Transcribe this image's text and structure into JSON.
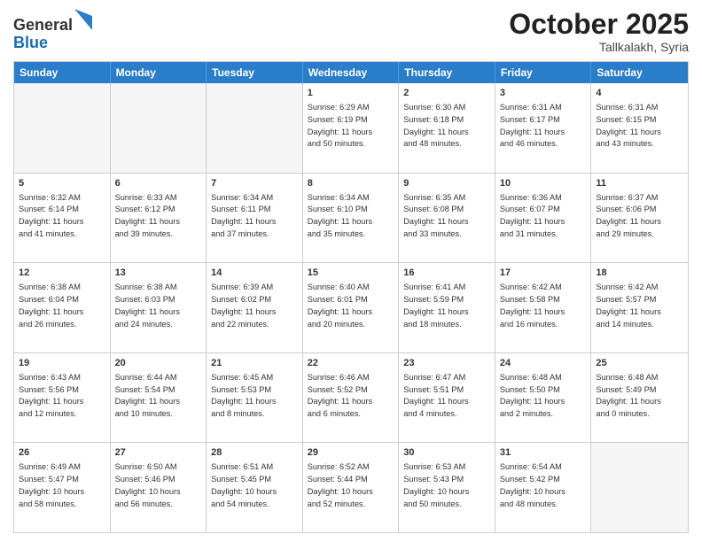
{
  "header": {
    "logo_general": "General",
    "logo_blue": "Blue",
    "month_title": "October 2025",
    "location": "Tallkalakh, Syria"
  },
  "weekdays": [
    "Sunday",
    "Monday",
    "Tuesday",
    "Wednesday",
    "Thursday",
    "Friday",
    "Saturday"
  ],
  "rows": [
    [
      {
        "day": "",
        "text": ""
      },
      {
        "day": "",
        "text": ""
      },
      {
        "day": "",
        "text": ""
      },
      {
        "day": "1",
        "text": "Sunrise: 6:29 AM\nSunset: 6:19 PM\nDaylight: 11 hours\nand 50 minutes."
      },
      {
        "day": "2",
        "text": "Sunrise: 6:30 AM\nSunset: 6:18 PM\nDaylight: 11 hours\nand 48 minutes."
      },
      {
        "day": "3",
        "text": "Sunrise: 6:31 AM\nSunset: 6:17 PM\nDaylight: 11 hours\nand 46 minutes."
      },
      {
        "day": "4",
        "text": "Sunrise: 6:31 AM\nSunset: 6:15 PM\nDaylight: 11 hours\nand 43 minutes."
      }
    ],
    [
      {
        "day": "5",
        "text": "Sunrise: 6:32 AM\nSunset: 6:14 PM\nDaylight: 11 hours\nand 41 minutes."
      },
      {
        "day": "6",
        "text": "Sunrise: 6:33 AM\nSunset: 6:12 PM\nDaylight: 11 hours\nand 39 minutes."
      },
      {
        "day": "7",
        "text": "Sunrise: 6:34 AM\nSunset: 6:11 PM\nDaylight: 11 hours\nand 37 minutes."
      },
      {
        "day": "8",
        "text": "Sunrise: 6:34 AM\nSunset: 6:10 PM\nDaylight: 11 hours\nand 35 minutes."
      },
      {
        "day": "9",
        "text": "Sunrise: 6:35 AM\nSunset: 6:08 PM\nDaylight: 11 hours\nand 33 minutes."
      },
      {
        "day": "10",
        "text": "Sunrise: 6:36 AM\nSunset: 6:07 PM\nDaylight: 11 hours\nand 31 minutes."
      },
      {
        "day": "11",
        "text": "Sunrise: 6:37 AM\nSunset: 6:06 PM\nDaylight: 11 hours\nand 29 minutes."
      }
    ],
    [
      {
        "day": "12",
        "text": "Sunrise: 6:38 AM\nSunset: 6:04 PM\nDaylight: 11 hours\nand 26 minutes."
      },
      {
        "day": "13",
        "text": "Sunrise: 6:38 AM\nSunset: 6:03 PM\nDaylight: 11 hours\nand 24 minutes."
      },
      {
        "day": "14",
        "text": "Sunrise: 6:39 AM\nSunset: 6:02 PM\nDaylight: 11 hours\nand 22 minutes."
      },
      {
        "day": "15",
        "text": "Sunrise: 6:40 AM\nSunset: 6:01 PM\nDaylight: 11 hours\nand 20 minutes."
      },
      {
        "day": "16",
        "text": "Sunrise: 6:41 AM\nSunset: 5:59 PM\nDaylight: 11 hours\nand 18 minutes."
      },
      {
        "day": "17",
        "text": "Sunrise: 6:42 AM\nSunset: 5:58 PM\nDaylight: 11 hours\nand 16 minutes."
      },
      {
        "day": "18",
        "text": "Sunrise: 6:42 AM\nSunset: 5:57 PM\nDaylight: 11 hours\nand 14 minutes."
      }
    ],
    [
      {
        "day": "19",
        "text": "Sunrise: 6:43 AM\nSunset: 5:56 PM\nDaylight: 11 hours\nand 12 minutes."
      },
      {
        "day": "20",
        "text": "Sunrise: 6:44 AM\nSunset: 5:54 PM\nDaylight: 11 hours\nand 10 minutes."
      },
      {
        "day": "21",
        "text": "Sunrise: 6:45 AM\nSunset: 5:53 PM\nDaylight: 11 hours\nand 8 minutes."
      },
      {
        "day": "22",
        "text": "Sunrise: 6:46 AM\nSunset: 5:52 PM\nDaylight: 11 hours\nand 6 minutes."
      },
      {
        "day": "23",
        "text": "Sunrise: 6:47 AM\nSunset: 5:51 PM\nDaylight: 11 hours\nand 4 minutes."
      },
      {
        "day": "24",
        "text": "Sunrise: 6:48 AM\nSunset: 5:50 PM\nDaylight: 11 hours\nand 2 minutes."
      },
      {
        "day": "25",
        "text": "Sunrise: 6:48 AM\nSunset: 5:49 PM\nDaylight: 11 hours\nand 0 minutes."
      }
    ],
    [
      {
        "day": "26",
        "text": "Sunrise: 6:49 AM\nSunset: 5:47 PM\nDaylight: 10 hours\nand 58 minutes."
      },
      {
        "day": "27",
        "text": "Sunrise: 6:50 AM\nSunset: 5:46 PM\nDaylight: 10 hours\nand 56 minutes."
      },
      {
        "day": "28",
        "text": "Sunrise: 6:51 AM\nSunset: 5:45 PM\nDaylight: 10 hours\nand 54 minutes."
      },
      {
        "day": "29",
        "text": "Sunrise: 6:52 AM\nSunset: 5:44 PM\nDaylight: 10 hours\nand 52 minutes."
      },
      {
        "day": "30",
        "text": "Sunrise: 6:53 AM\nSunset: 5:43 PM\nDaylight: 10 hours\nand 50 minutes."
      },
      {
        "day": "31",
        "text": "Sunrise: 6:54 AM\nSunset: 5:42 PM\nDaylight: 10 hours\nand 48 minutes."
      },
      {
        "day": "",
        "text": ""
      }
    ]
  ]
}
